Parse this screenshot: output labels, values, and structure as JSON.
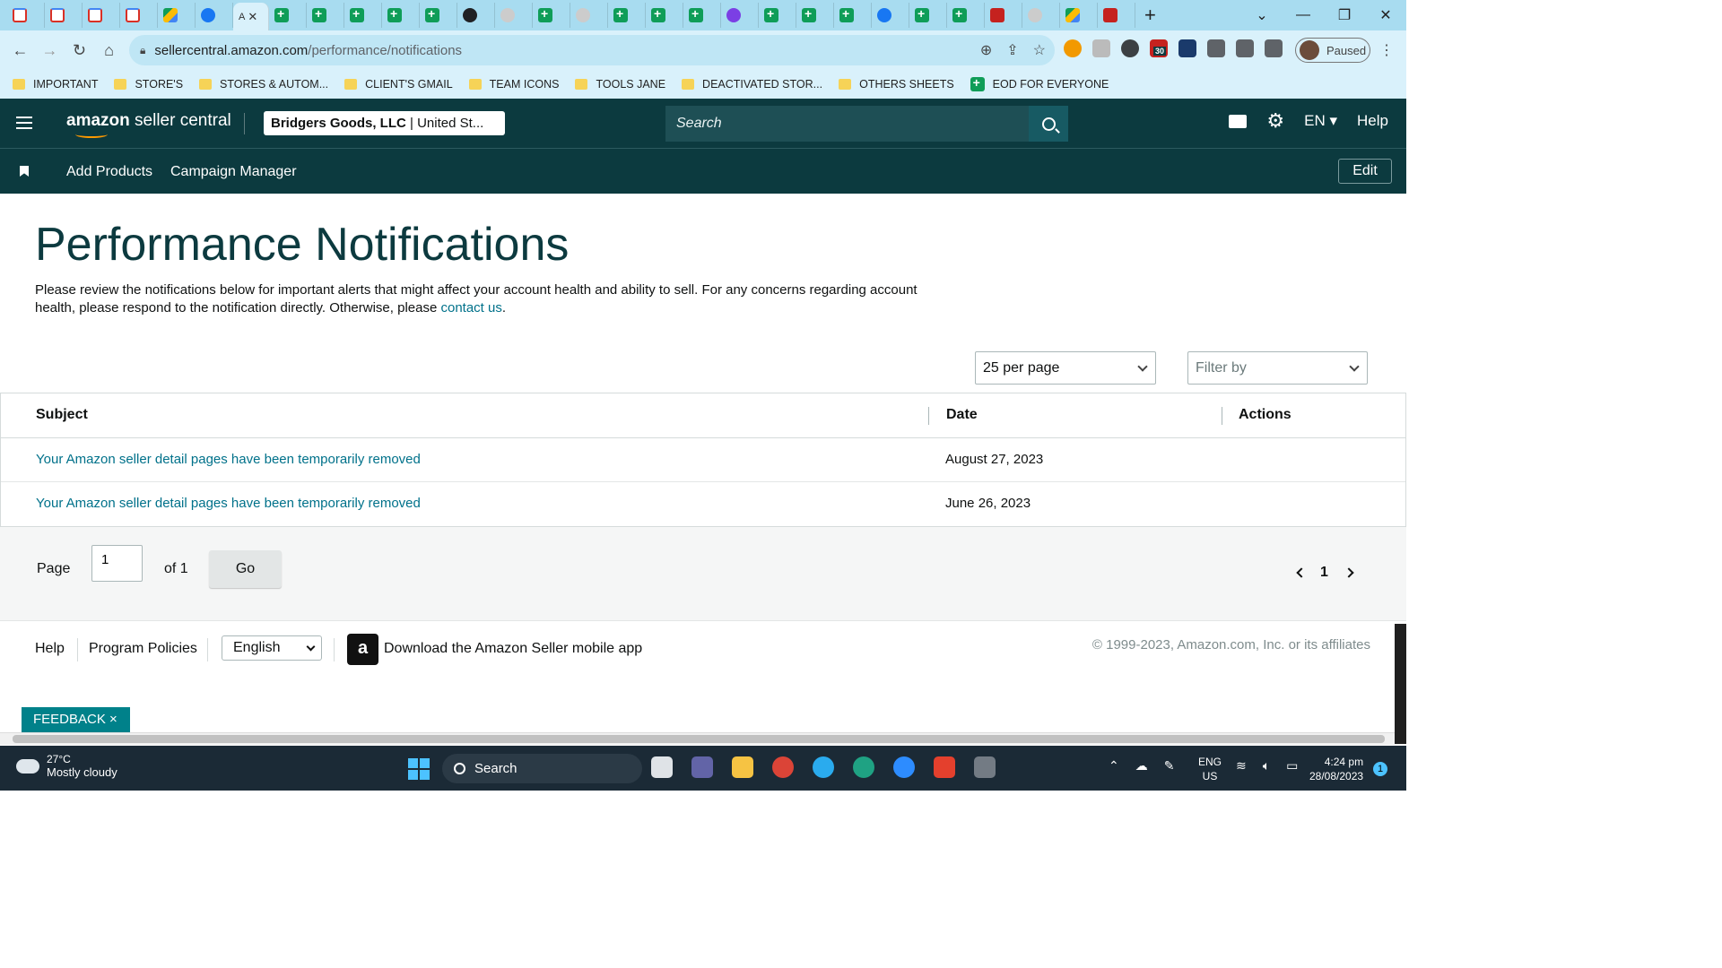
{
  "browser": {
    "active_tab_label": "A",
    "url_host": "sellercentral.amazon.com",
    "url_path": "/performance/notifications",
    "profile_status": "Paused",
    "extension_badge": "30"
  },
  "bookmarks": [
    {
      "label": "IMPORTANT"
    },
    {
      "label": "STORE'S"
    },
    {
      "label": "STORES & AUTOM..."
    },
    {
      "label": "CLIENT'S GMAIL"
    },
    {
      "label": "TEAM ICONS"
    },
    {
      "label": "TOOLS JANE"
    },
    {
      "label": "DEACTIVATED STOR..."
    },
    {
      "label": "OTHERS SHEETS"
    },
    {
      "label": "EOD FOR EVERYONE"
    }
  ],
  "header": {
    "logo_bold": "amazon",
    "logo_rest": " seller central",
    "store_name": "Bridgers Goods, LLC",
    "store_region": " | United St...",
    "search_placeholder": "Search",
    "language": "EN",
    "help": "Help"
  },
  "subnav": {
    "items": [
      "Add Products",
      "Campaign Manager"
    ],
    "edit": "Edit"
  },
  "page": {
    "title": "Performance Notifications",
    "intro": "Please review the notifications below for important alerts that might affect your account health and ability to sell. For any concerns regarding account health, please respond to the notification directly. Otherwise, please ",
    "intro_link": "contact us",
    "intro_end": "."
  },
  "controls": {
    "per_page": "25 per page",
    "filter_placeholder": "Filter by"
  },
  "table": {
    "headers": [
      "Subject",
      "Date",
      "Actions"
    ],
    "rows": [
      {
        "subject": "Your Amazon seller detail pages have been temporarily removed",
        "date": "August 27, 2023"
      },
      {
        "subject": "Your Amazon seller detail pages have been temporarily removed",
        "date": "June 26, 2023"
      }
    ]
  },
  "pagination": {
    "page_label": "Page",
    "page_value": "1",
    "of_label": "of 1",
    "go": "Go",
    "current": "1"
  },
  "footer": {
    "help": "Help",
    "policies": "Program Policies",
    "language": "English",
    "app_text": "Download the Amazon Seller mobile app",
    "copyright": "© 1999-2023, Amazon.com, Inc. or its affiliates",
    "feedback": "FEEDBACK ×"
  },
  "taskbar": {
    "temp": "27°C",
    "weather": "Mostly cloudy",
    "search": "Search",
    "lang1": "ENG",
    "lang2": "US",
    "time": "4:24 pm",
    "date": "28/08/2023",
    "notifications": "1"
  }
}
